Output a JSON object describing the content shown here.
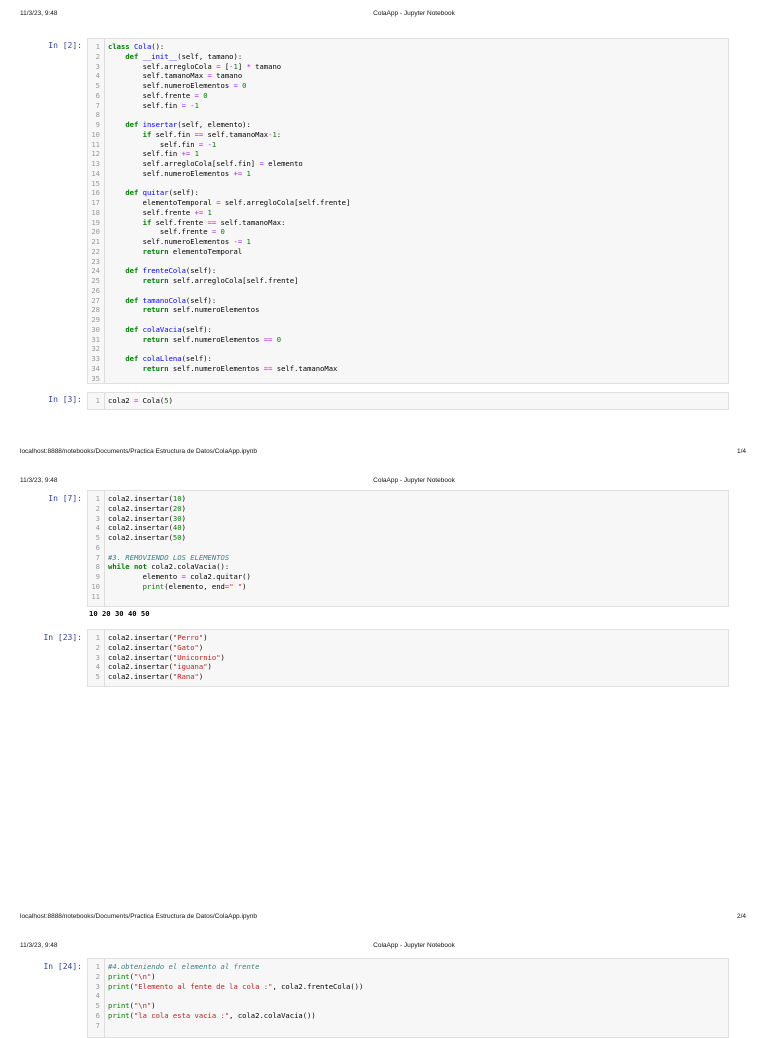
{
  "pages": [
    {
      "date": "11/3/23, 9:48",
      "title": "ColaApp - Jupyter Notebook",
      "url": "localhost:8888/notebooks/Documents/Practica Estructura de Datos/ColaApp.ipynb",
      "page": "1/4"
    },
    {
      "date": "11/3/23, 9:48",
      "title": "ColaApp - Jupyter Notebook",
      "url": "localhost:8888/notebooks/Documents/Practica Estructura de Datos/ColaApp.ipynb",
      "page": "2/4"
    },
    {
      "date": "11/3/23, 9:48",
      "title": "ColaApp - Jupyter Notebook"
    }
  ],
  "cells": [
    {
      "prompt": "In [2]:",
      "lines": [
        [
          [
            "k",
            "class "
          ],
          [
            "d",
            "Cola"
          ],
          [
            "t",
            "():"
          ]
        ],
        [
          [
            "t",
            "    "
          ],
          [
            "k",
            "def "
          ],
          [
            "d",
            "__init__"
          ],
          [
            "t",
            "(self, tamano):"
          ]
        ],
        [
          [
            "t",
            "        self.arregloCola "
          ],
          [
            "o",
            "="
          ],
          [
            "t",
            " ["
          ],
          [
            "o",
            "-"
          ],
          [
            "n",
            "1"
          ],
          [
            "t",
            "] "
          ],
          [
            "o",
            "*"
          ],
          [
            "t",
            " tamano"
          ]
        ],
        [
          [
            "t",
            "        self.tamanoMax "
          ],
          [
            "o",
            "="
          ],
          [
            "t",
            " tamano"
          ]
        ],
        [
          [
            "t",
            "        self.numeroElementos "
          ],
          [
            "o",
            "="
          ],
          [
            "t",
            " "
          ],
          [
            "n",
            "0"
          ]
        ],
        [
          [
            "t",
            "        self.frente "
          ],
          [
            "o",
            "="
          ],
          [
            "t",
            " "
          ],
          [
            "n",
            "0"
          ]
        ],
        [
          [
            "t",
            "        self.fin "
          ],
          [
            "o",
            "="
          ],
          [
            "t",
            " "
          ],
          [
            "o",
            "-"
          ],
          [
            "n",
            "1"
          ]
        ],
        [],
        [
          [
            "t",
            "    "
          ],
          [
            "k",
            "def "
          ],
          [
            "d",
            "insertar"
          ],
          [
            "t",
            "(self, elemento):"
          ]
        ],
        [
          [
            "t",
            "        "
          ],
          [
            "k",
            "if"
          ],
          [
            "t",
            " self.fin "
          ],
          [
            "o",
            "=="
          ],
          [
            "t",
            " self.tamanoMax"
          ],
          [
            "o",
            "-"
          ],
          [
            "n",
            "1"
          ],
          [
            "t",
            ":"
          ]
        ],
        [
          [
            "t",
            "            self.fin "
          ],
          [
            "o",
            "="
          ],
          [
            "t",
            " "
          ],
          [
            "o",
            "-"
          ],
          [
            "n",
            "1"
          ]
        ],
        [
          [
            "t",
            "        self.fin "
          ],
          [
            "o",
            "+="
          ],
          [
            "t",
            " "
          ],
          [
            "n",
            "1"
          ]
        ],
        [
          [
            "t",
            "        self.arregloCola[self.fin] "
          ],
          [
            "o",
            "="
          ],
          [
            "t",
            " elemento"
          ]
        ],
        [
          [
            "t",
            "        self.numeroElementos "
          ],
          [
            "o",
            "+="
          ],
          [
            "t",
            " "
          ],
          [
            "n",
            "1"
          ]
        ],
        [],
        [
          [
            "t",
            "    "
          ],
          [
            "k",
            "def "
          ],
          [
            "d",
            "quitar"
          ],
          [
            "t",
            "(self):"
          ]
        ],
        [
          [
            "t",
            "        elementoTemporal "
          ],
          [
            "o",
            "="
          ],
          [
            "t",
            " self.arregloCola[self.frente]"
          ]
        ],
        [
          [
            "t",
            "        self.frente "
          ],
          [
            "o",
            "+="
          ],
          [
            "t",
            " "
          ],
          [
            "n",
            "1"
          ]
        ],
        [
          [
            "t",
            "        "
          ],
          [
            "k",
            "if"
          ],
          [
            "t",
            " self.frente "
          ],
          [
            "o",
            "=="
          ],
          [
            "t",
            " self.tamanoMax:"
          ]
        ],
        [
          [
            "t",
            "            self.frente "
          ],
          [
            "o",
            "="
          ],
          [
            "t",
            " "
          ],
          [
            "n",
            "0"
          ]
        ],
        [
          [
            "t",
            "        self.numeroElementos "
          ],
          [
            "o",
            "-="
          ],
          [
            "t",
            " "
          ],
          [
            "n",
            "1"
          ]
        ],
        [
          [
            "t",
            "        "
          ],
          [
            "k",
            "return"
          ],
          [
            "t",
            " elementoTemporal"
          ]
        ],
        [],
        [
          [
            "t",
            "    "
          ],
          [
            "k",
            "def "
          ],
          [
            "d",
            "frenteCola"
          ],
          [
            "t",
            "(self):"
          ]
        ],
        [
          [
            "t",
            "        "
          ],
          [
            "k",
            "return"
          ],
          [
            "t",
            " self.arregloCola[self.frente]"
          ]
        ],
        [],
        [
          [
            "t",
            "    "
          ],
          [
            "k",
            "def "
          ],
          [
            "d",
            "tamanoCola"
          ],
          [
            "t",
            "(self):"
          ]
        ],
        [
          [
            "t",
            "        "
          ],
          [
            "k",
            "return"
          ],
          [
            "t",
            " self.numeroElementos"
          ]
        ],
        [],
        [
          [
            "t",
            "    "
          ],
          [
            "k",
            "def "
          ],
          [
            "d",
            "colaVacia"
          ],
          [
            "t",
            "(self):"
          ]
        ],
        [
          [
            "t",
            "        "
          ],
          [
            "k",
            "return"
          ],
          [
            "t",
            " self.numeroElementos "
          ],
          [
            "o",
            "=="
          ],
          [
            "t",
            " "
          ],
          [
            "n",
            "0"
          ]
        ],
        [],
        [
          [
            "t",
            "    "
          ],
          [
            "k",
            "def "
          ],
          [
            "d",
            "colaLlena"
          ],
          [
            "t",
            "(self):"
          ]
        ],
        [
          [
            "t",
            "        "
          ],
          [
            "k",
            "return"
          ],
          [
            "t",
            " self.numeroElementos "
          ],
          [
            "o",
            "=="
          ],
          [
            "t",
            " self.tamanoMax"
          ]
        ],
        []
      ]
    },
    {
      "prompt": "In [3]:",
      "lines": [
        [
          [
            "t",
            "cola2 "
          ],
          [
            "o",
            "="
          ],
          [
            "t",
            " Cola("
          ],
          [
            "n",
            "5"
          ],
          [
            "t",
            ")"
          ]
        ]
      ]
    },
    {
      "prompt": "In [7]:",
      "lines": [
        [
          [
            "t",
            "cola2.insertar("
          ],
          [
            "n",
            "10"
          ],
          [
            "t",
            ")"
          ]
        ],
        [
          [
            "t",
            "cola2.insertar("
          ],
          [
            "n",
            "20"
          ],
          [
            "t",
            ")"
          ]
        ],
        [
          [
            "t",
            "cola2.insertar("
          ],
          [
            "n",
            "30"
          ],
          [
            "t",
            ")"
          ]
        ],
        [
          [
            "t",
            "cola2.insertar("
          ],
          [
            "n",
            "40"
          ],
          [
            "t",
            ")"
          ]
        ],
        [
          [
            "t",
            "cola2.insertar("
          ],
          [
            "n",
            "50"
          ],
          [
            "t",
            ")"
          ]
        ],
        [],
        [
          [
            "c",
            "#3. REMOVIENDO LOS ELEMENTOS"
          ]
        ],
        [
          [
            "k",
            "while"
          ],
          [
            "t",
            " "
          ],
          [
            "k",
            "not"
          ],
          [
            "t",
            " cola2.colaVacia():"
          ]
        ],
        [
          [
            "t",
            "        elemento "
          ],
          [
            "o",
            "="
          ],
          [
            "t",
            " cola2.quitar()"
          ]
        ],
        [
          [
            "t",
            "        "
          ],
          [
            "b",
            "print"
          ],
          [
            "t",
            "(elemento, end"
          ],
          [
            "o",
            "="
          ],
          [
            "s",
            "\" \""
          ],
          [
            "t",
            ")"
          ]
        ],
        []
      ],
      "output": "10 20 30 40 50"
    },
    {
      "prompt": "In [23]:",
      "lines": [
        [
          [
            "t",
            "cola2.insertar("
          ],
          [
            "s",
            "\"Perro\""
          ],
          [
            "t",
            ")"
          ]
        ],
        [
          [
            "t",
            "cola2.insertar("
          ],
          [
            "s",
            "\"Gato\""
          ],
          [
            "t",
            ")"
          ]
        ],
        [
          [
            "t",
            "cola2.insertar("
          ],
          [
            "s",
            "\"Unicornio\""
          ],
          [
            "t",
            ")"
          ]
        ],
        [
          [
            "t",
            "cola2.insertar("
          ],
          [
            "s",
            "\"iguana\""
          ],
          [
            "t",
            ")"
          ]
        ],
        [
          [
            "t",
            "cola2.insertar("
          ],
          [
            "s",
            "\"Rana\""
          ],
          [
            "t",
            ")"
          ]
        ]
      ]
    },
    {
      "prompt": "In [24]:",
      "lines": [
        [
          [
            "c",
            "#4.obteniendo el elemento al frente"
          ]
        ],
        [
          [
            "b",
            "print"
          ],
          [
            "t",
            "("
          ],
          [
            "s",
            "\"\\n\""
          ],
          [
            "t",
            ")"
          ]
        ],
        [
          [
            "b",
            "print"
          ],
          [
            "t",
            "("
          ],
          [
            "s",
            "\"Elemento al fente de la cola :\""
          ],
          [
            "t",
            ", cola2.frenteCola())"
          ]
        ],
        [],
        [
          [
            "b",
            "print"
          ],
          [
            "t",
            "("
          ],
          [
            "s",
            "\"\\n\""
          ],
          [
            "t",
            ")"
          ]
        ],
        [
          [
            "b",
            "print"
          ],
          [
            "t",
            "("
          ],
          [
            "s",
            "\"la cola esta vacia :\""
          ],
          [
            "t",
            ", cola2.colaVacia())"
          ]
        ],
        []
      ]
    }
  ]
}
